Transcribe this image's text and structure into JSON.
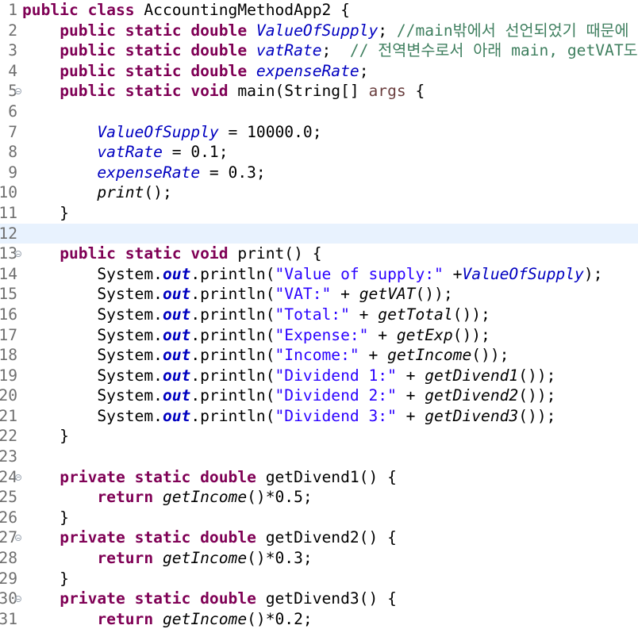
{
  "editor": {
    "language": "java",
    "colors": {
      "background": "#ffffff",
      "current_line": "#e8f2fe",
      "line_number": "#6f6f6f",
      "keyword": "#7f0055",
      "static_field": "#0000c0",
      "comment": "#3f7f5f",
      "string": "#2a00ff",
      "parameter": "#6a3e3e"
    },
    "current_line_number": 12,
    "lines": [
      {
        "n": "1",
        "fold": false,
        "tokens": [
          [
            "kw",
            "public"
          ],
          [
            "",
            "&nbsp;"
          ],
          [
            "kw",
            "class"
          ],
          [
            "",
            "",
            " AccountingMethodApp2 {"
          ]
        ]
      }
    ]
  }
}
